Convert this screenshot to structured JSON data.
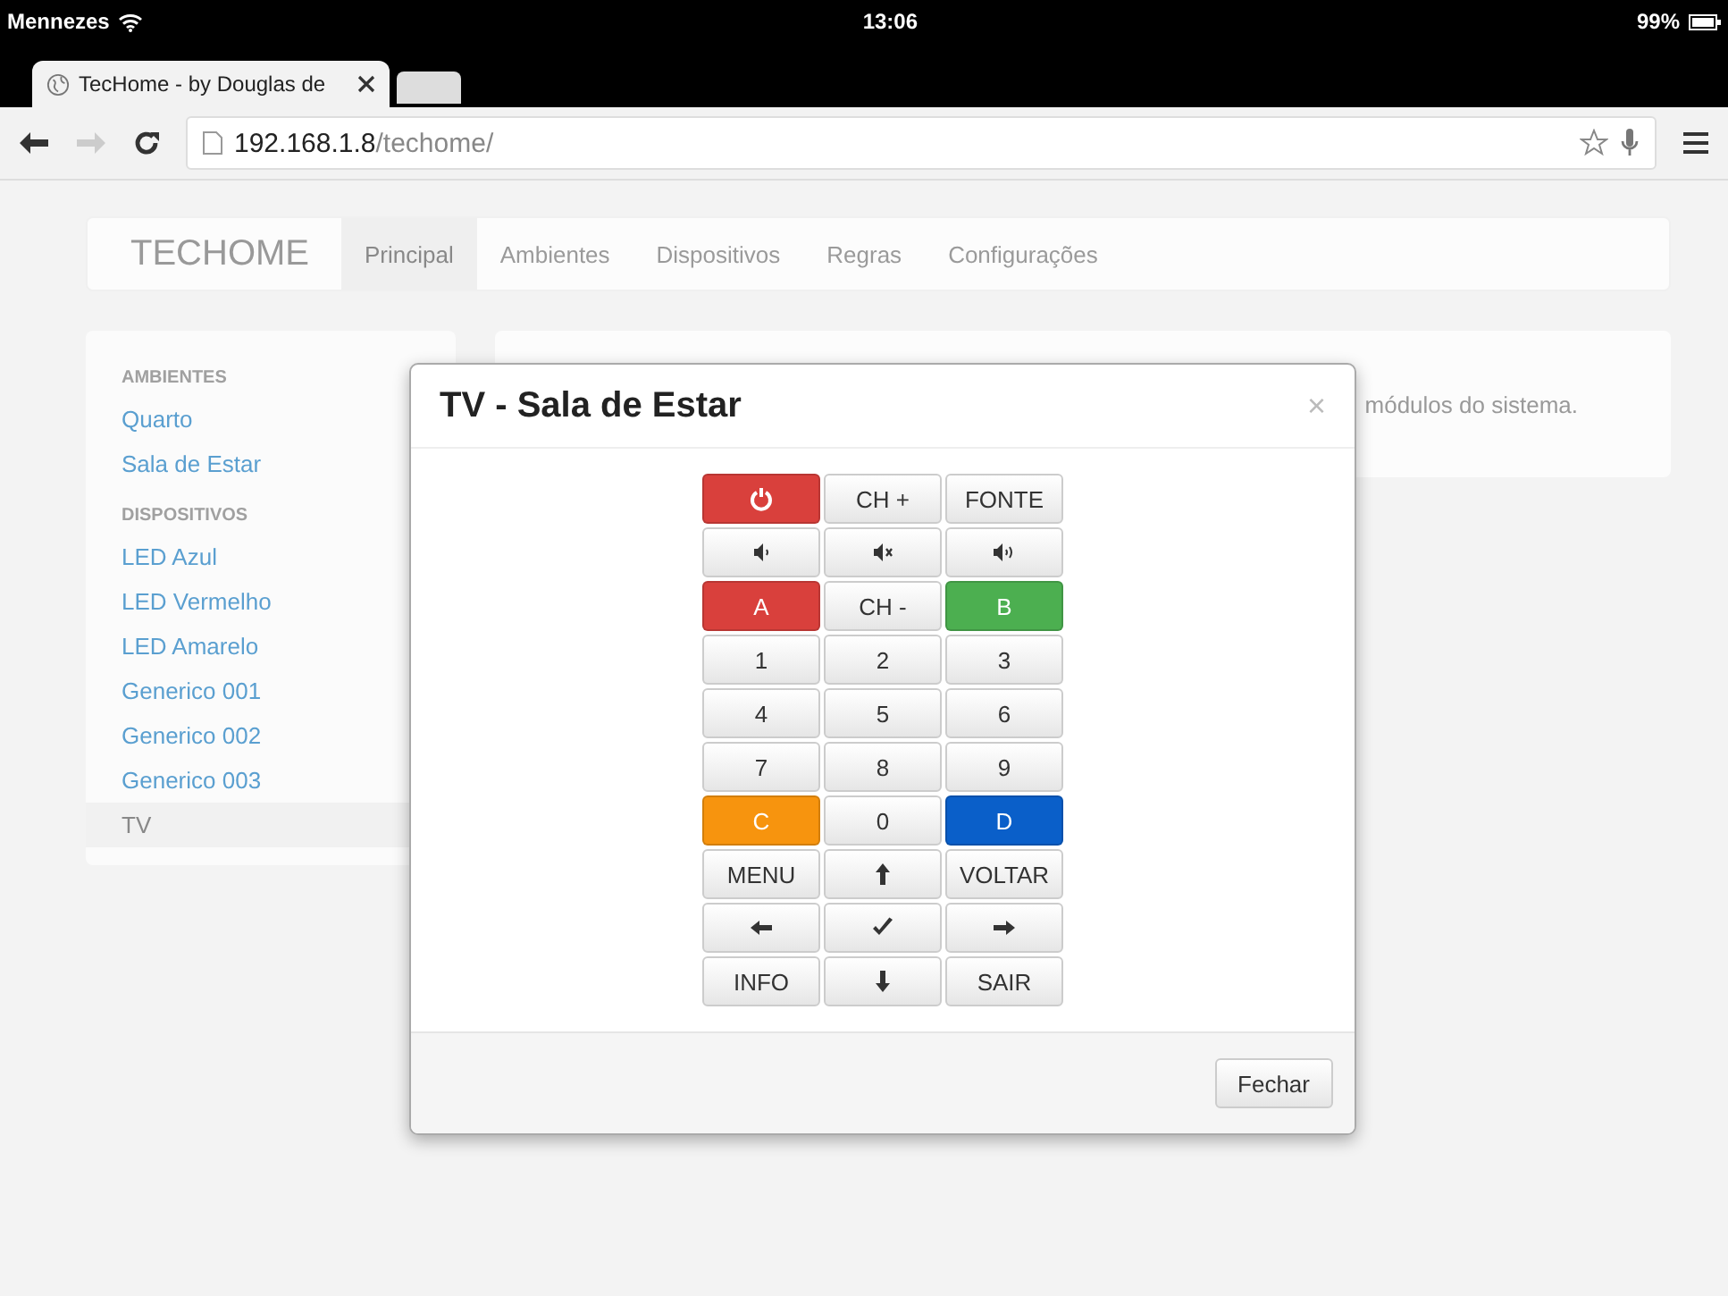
{
  "status_bar": {
    "carrier": "Mennezes",
    "time": "13:06",
    "battery": "99%"
  },
  "browser": {
    "tab_title": "TecHome - by Douglas de",
    "url_host": "192.168.1.8",
    "url_path": "/techome/"
  },
  "navbar": {
    "brand": "TECHOME",
    "items": [
      {
        "label": "Principal",
        "selected": true
      },
      {
        "label": "Ambientes",
        "selected": false
      },
      {
        "label": "Dispositivos",
        "selected": false
      },
      {
        "label": "Regras",
        "selected": false
      },
      {
        "label": "Configurações",
        "selected": false
      }
    ]
  },
  "sidebar": {
    "sections": [
      {
        "heading": "AMBIENTES",
        "items": [
          {
            "label": "Quarto",
            "selected": false
          },
          {
            "label": "Sala de Estar",
            "selected": false
          }
        ]
      },
      {
        "heading": "DISPOSITIVOS",
        "items": [
          {
            "label": "LED Azul",
            "selected": false
          },
          {
            "label": "LED Vermelho",
            "selected": false
          },
          {
            "label": "LED Amarelo",
            "selected": false
          },
          {
            "label": "Generico 001",
            "selected": false
          },
          {
            "label": "Generico 002",
            "selected": false
          },
          {
            "label": "Generico 003",
            "selected": false
          },
          {
            "label": "TV",
            "selected": true
          }
        ]
      }
    ]
  },
  "jumbotron": {
    "text": "módulos do sistema."
  },
  "modal": {
    "title": "TV - Sala de Estar",
    "close": "×",
    "buttons": [
      {
        "kind": "power",
        "color": "#d9403c"
      },
      {
        "kind": "text",
        "label": "CH +"
      },
      {
        "kind": "text",
        "label": "FONTE"
      },
      {
        "kind": "volume-down"
      },
      {
        "kind": "mute"
      },
      {
        "kind": "volume-up"
      },
      {
        "kind": "text",
        "label": "A",
        "color": "#d9403c"
      },
      {
        "kind": "text",
        "label": "CH -"
      },
      {
        "kind": "text",
        "label": "B",
        "color": "#4caf50"
      },
      {
        "kind": "text",
        "label": "1"
      },
      {
        "kind": "text",
        "label": "2"
      },
      {
        "kind": "text",
        "label": "3"
      },
      {
        "kind": "text",
        "label": "4"
      },
      {
        "kind": "text",
        "label": "5"
      },
      {
        "kind": "text",
        "label": "6"
      },
      {
        "kind": "text",
        "label": "7"
      },
      {
        "kind": "text",
        "label": "8"
      },
      {
        "kind": "text",
        "label": "9"
      },
      {
        "kind": "text",
        "label": "C",
        "color": "#f7940e"
      },
      {
        "kind": "text",
        "label": "0"
      },
      {
        "kind": "text",
        "label": "D",
        "color": "#0a5fc9"
      },
      {
        "kind": "text",
        "label": "MENU"
      },
      {
        "kind": "arrow-up"
      },
      {
        "kind": "text",
        "label": "VOLTAR"
      },
      {
        "kind": "arrow-left"
      },
      {
        "kind": "check"
      },
      {
        "kind": "arrow-right"
      },
      {
        "kind": "text",
        "label": "INFO"
      },
      {
        "kind": "arrow-down"
      },
      {
        "kind": "text",
        "label": "SAIR"
      }
    ],
    "footer_button": "Fechar"
  }
}
